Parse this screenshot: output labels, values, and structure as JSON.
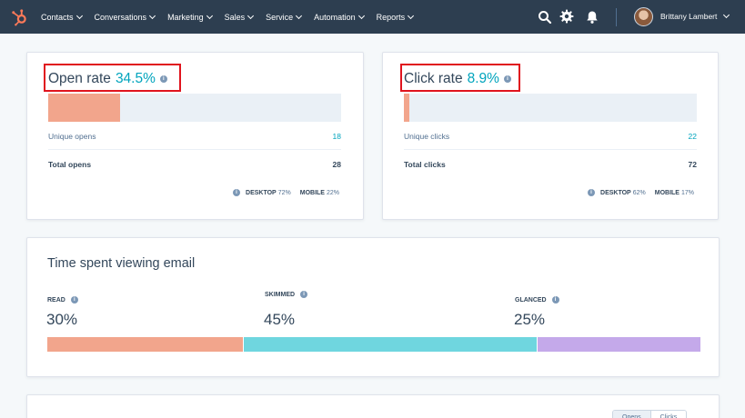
{
  "nav": {
    "items": [
      {
        "label": "Contacts"
      },
      {
        "label": "Conversations"
      },
      {
        "label": "Marketing"
      },
      {
        "label": "Sales"
      },
      {
        "label": "Service"
      },
      {
        "label": "Automation"
      },
      {
        "label": "Reports"
      }
    ],
    "user_name": "Brittany Lambert"
  },
  "open_card": {
    "title": "Open rate",
    "rate": "34.5%",
    "rate_fraction": 0.245,
    "rows": [
      {
        "label": "Unique opens",
        "value": "18"
      },
      {
        "label": "Total opens",
        "value": "28"
      }
    ],
    "devices": {
      "desktop_label": "DESKTOP",
      "desktop_pct": "72%",
      "mobile_label": "MOBILE",
      "mobile_pct": "22%"
    }
  },
  "click_card": {
    "title": "Click rate",
    "rate": "8.9%",
    "rate_fraction": 0.02,
    "rows": [
      {
        "label": "Unique clicks",
        "value": "22"
      },
      {
        "label": "Total clicks",
        "value": "72"
      }
    ],
    "devices": {
      "desktop_label": "DESKTOP",
      "desktop_pct": "62%",
      "mobile_label": "MOBILE",
      "mobile_pct": "17%"
    }
  },
  "time_card": {
    "title": "Time spent viewing email",
    "segments": [
      {
        "label": "READ",
        "value": "30%",
        "fraction": 0.3
      },
      {
        "label": "SKIMMED",
        "value": "45%",
        "fraction": 0.45
      },
      {
        "label": "GLANCED",
        "value": "25%",
        "fraction": 0.25
      }
    ]
  },
  "bottom_card": {
    "toggle_left": "Opens",
    "toggle_right": "Clicks"
  },
  "colors": {
    "nav_bg": "#2d3e50",
    "accent": "#00a4bd",
    "read": "#f2a58c",
    "skimmed": "#6fd6df",
    "glanced": "#c4a9ea",
    "highlight": "#e0141e"
  }
}
